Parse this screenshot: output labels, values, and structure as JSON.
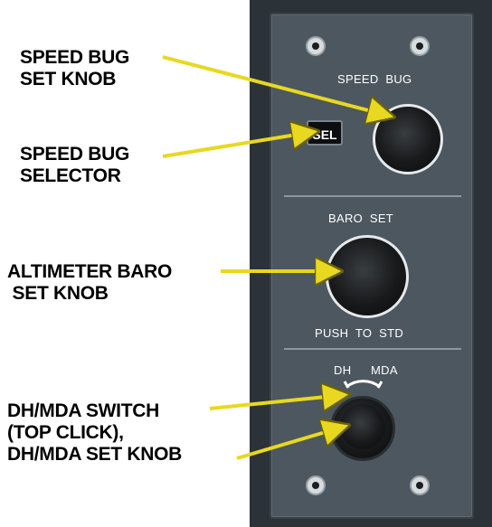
{
  "callouts": {
    "speed_bug_set_knob": [
      "SPEED BUG",
      "SET KNOB"
    ],
    "speed_bug_selector": [
      "SPEED BUG",
      "SELECTOR"
    ],
    "altimeter_baro_set_knob": [
      "ALTIMETER BARO",
      " SET KNOB"
    ],
    "dh_mda": [
      "DH/MDA SWITCH",
      "(TOP CLICK),",
      "DH/MDA SET KNOB"
    ]
  },
  "panel": {
    "speed_bug_label": "SPEED  BUG",
    "sel_button_label": "SEL",
    "baro_set_label": "BARO  SET",
    "push_to_std_label": "PUSH  TO  STD",
    "dh_label": "DH",
    "mda_label": "MDA"
  },
  "colors": {
    "arrow": "#e8d820",
    "panel_face": "#4d575f",
    "panel_frame": "#2c3338"
  }
}
